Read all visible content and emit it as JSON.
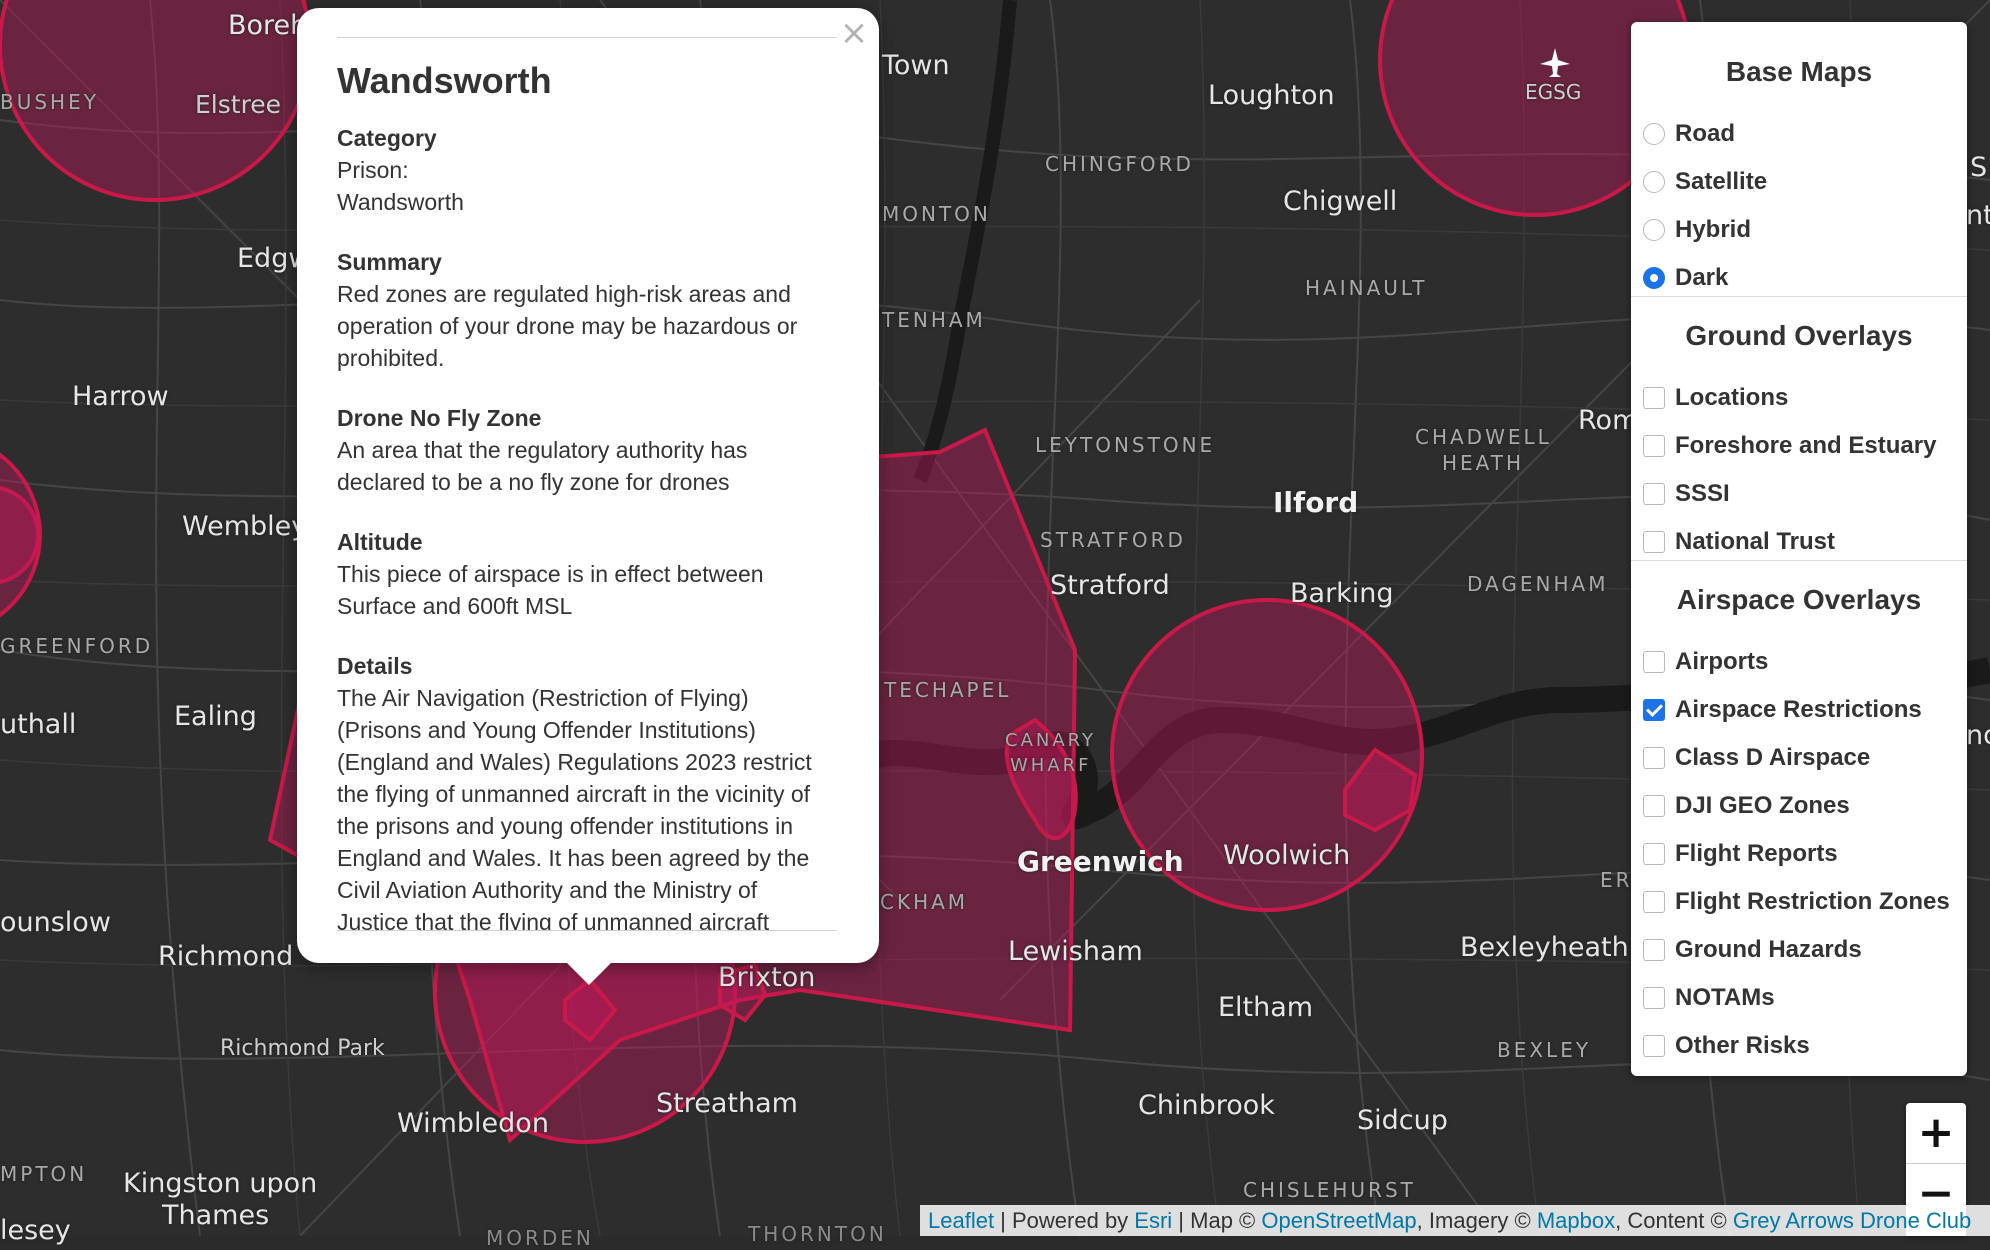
{
  "map": {
    "places": [
      {
        "text": "Boreh"
      },
      {
        "text": "BUSHEY"
      },
      {
        "text": "Elstree"
      },
      {
        "text": "Town"
      },
      {
        "text": "Loughton"
      },
      {
        "text": "EGSG"
      },
      {
        "text": "CHINGFORD"
      },
      {
        "text": "Chigwell"
      },
      {
        "text": "MONTON"
      },
      {
        "text": "HAINAULT"
      },
      {
        "text": "Edgw"
      },
      {
        "text": "TENHAM"
      },
      {
        "text": "Harrow"
      },
      {
        "text": "LEYTONSTONE"
      },
      {
        "text": "CHADWELL"
      },
      {
        "text": "HEATH"
      },
      {
        "text": "Rom"
      },
      {
        "text": "Ilford"
      },
      {
        "text": "Wembley"
      },
      {
        "text": "STRATFORD"
      },
      {
        "text": "Stratford"
      },
      {
        "text": "Barking"
      },
      {
        "text": "DAGENHAM"
      },
      {
        "text": "GREENFORD"
      },
      {
        "text": "TECHAPEL"
      },
      {
        "text": "uthall"
      },
      {
        "text": "Ealing"
      },
      {
        "text": "CANARY"
      },
      {
        "text": "WHARF"
      },
      {
        "text": "Greenwich"
      },
      {
        "text": "Woolwich"
      },
      {
        "text": "ounslow"
      },
      {
        "text": "CKHAM"
      },
      {
        "text": "Richmond"
      },
      {
        "text": "Lewisham"
      },
      {
        "text": "Bexleyheath"
      },
      {
        "text": "Brixton"
      },
      {
        "text": "Eltham"
      },
      {
        "text": "Richmond Park"
      },
      {
        "text": "BEXLEY"
      },
      {
        "text": "Streatham"
      },
      {
        "text": "Wimbledon"
      },
      {
        "text": "Chinbrook"
      },
      {
        "text": "Sidcup"
      },
      {
        "text": "MPTON"
      },
      {
        "text": "Kingston upon"
      },
      {
        "text": "Thames"
      },
      {
        "text": "CHISLEHURST"
      },
      {
        "text": "lesey"
      },
      {
        "text": "THORNTON"
      },
      {
        "text": "MORDEN"
      },
      {
        "text": "ER"
      },
      {
        "text": "nt"
      },
      {
        "text": "nd"
      },
      {
        "text": "S"
      }
    ],
    "zone_color": "#c2185b"
  },
  "popup": {
    "title": "Wandsworth",
    "close_glyph": "×",
    "sections": [
      {
        "label": "Category",
        "lines": [
          "Prison:",
          "Wandsworth"
        ]
      },
      {
        "label": "Summary",
        "lines": [
          "Red zones are regulated high-risk areas and",
          "operation of your drone may be hazardous or",
          "prohibited."
        ]
      },
      {
        "label": "Drone No Fly Zone",
        "lines": [
          "An area that the regulatory authority has",
          "declared to be a no fly zone for drones"
        ]
      },
      {
        "label": "Altitude",
        "lines": [
          "This piece of airspace is in effect between",
          "Surface and 600ft MSL"
        ]
      },
      {
        "label": "Details",
        "lines": [
          "The Air Navigation (Restriction of Flying)",
          "(Prisons and Young Offender Institutions)",
          "(England and Wales) Regulations 2023 restrict",
          "the flying of unmanned aircraft in the vicinity of",
          "the prisons and young offender institutions in",
          "England and Wales. It has been agreed by the",
          "Civil Aviation Authority and the Ministry of",
          "Justice that the flying of unmanned aircraft"
        ]
      }
    ]
  },
  "layers": {
    "base_title": "Base Maps",
    "base": [
      {
        "label": "Road",
        "checked": false
      },
      {
        "label": "Satellite",
        "checked": false
      },
      {
        "label": "Hybrid",
        "checked": false
      },
      {
        "label": "Dark",
        "checked": true
      }
    ],
    "ground_title": "Ground Overlays",
    "ground": [
      {
        "label": "Locations",
        "checked": false
      },
      {
        "label": "Foreshore and Estuary",
        "checked": false
      },
      {
        "label": "SSSI",
        "checked": false
      },
      {
        "label": "National Trust",
        "checked": false
      }
    ],
    "air_title": "Airspace Overlays",
    "air": [
      {
        "label": "Airports",
        "checked": false
      },
      {
        "label": "Airspace Restrictions",
        "checked": true
      },
      {
        "label": "Class D Airspace",
        "checked": false
      },
      {
        "label": "DJI GEO Zones",
        "checked": false
      },
      {
        "label": "Flight Reports",
        "checked": false
      },
      {
        "label": "Flight Restriction Zones",
        "checked": false
      },
      {
        "label": "Ground Hazards",
        "checked": false
      },
      {
        "label": "NOTAMs",
        "checked": false
      },
      {
        "label": "Other Risks",
        "checked": false
      }
    ]
  },
  "zoom": {
    "in": "+",
    "out": "−"
  },
  "attribution": {
    "leaflet": "Leaflet",
    "sep1": " | Powered by ",
    "esri": "Esri",
    "sep2": " | Map © ",
    "osm": "OpenStreetMap",
    "sep3": ", Imagery © ",
    "mapbox": "Mapbox",
    "sep4": ", Content © ",
    "grey": "Grey Arrows Drone Club"
  }
}
